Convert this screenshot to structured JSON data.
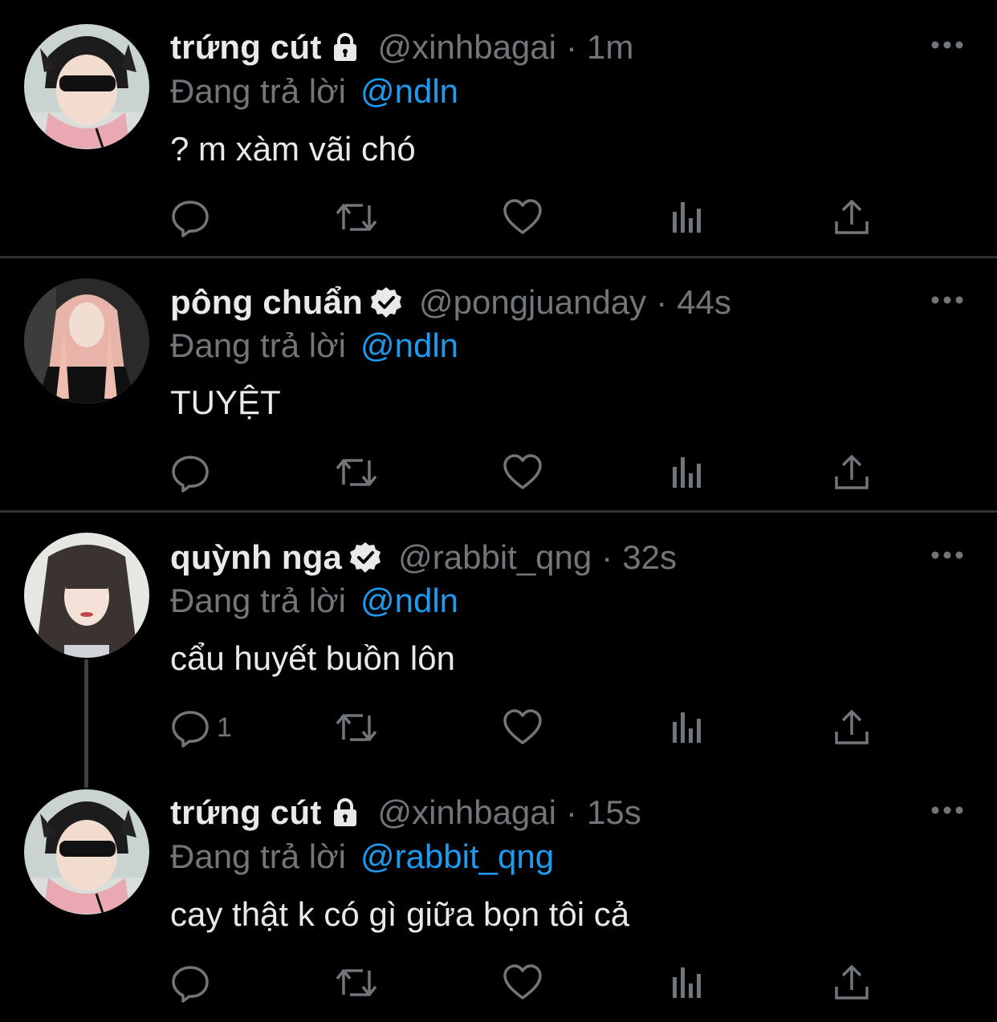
{
  "colors": {
    "background": "#000000",
    "text": "#e7e9ea",
    "muted": "#71767b",
    "link": "#1d9bf0",
    "divider": "#2f3336"
  },
  "tweets": [
    {
      "name": "trứng cút",
      "badge": "lock-icon",
      "handle": "@xinhbagai",
      "separator": "·",
      "time": "1m",
      "reply_label": "Đang trả lời",
      "reply_to": "@ndln",
      "text": "? m xàm vãi chó",
      "reply_count": ""
    },
    {
      "name": "pông chuẩn",
      "badge": "verified-icon",
      "handle": "@pongjuanday",
      "separator": "·",
      "time": "44s",
      "reply_label": "Đang trả lời",
      "reply_to": "@ndln",
      "text": "TUYỆT",
      "reply_count": ""
    },
    {
      "name": "quỳnh nga",
      "badge": "verified-icon",
      "handle": "@rabbit_qng",
      "separator": "·",
      "time": "32s",
      "reply_label": "Đang trả lời",
      "reply_to": "@ndln",
      "text": "cẩu huyết buồn lôn",
      "reply_count": "1"
    },
    {
      "name": "trứng cút",
      "badge": "lock-icon",
      "handle": "@xinhbagai",
      "separator": "·",
      "time": "15s",
      "reply_label": "Đang trả lời",
      "reply_to": "@rabbit_qng",
      "text": "cay thật k có gì giữa bọn tôi cả",
      "reply_count": ""
    }
  ],
  "action_icons": [
    "reply-icon",
    "retweet-icon",
    "like-icon",
    "views-icon",
    "share-icon"
  ]
}
